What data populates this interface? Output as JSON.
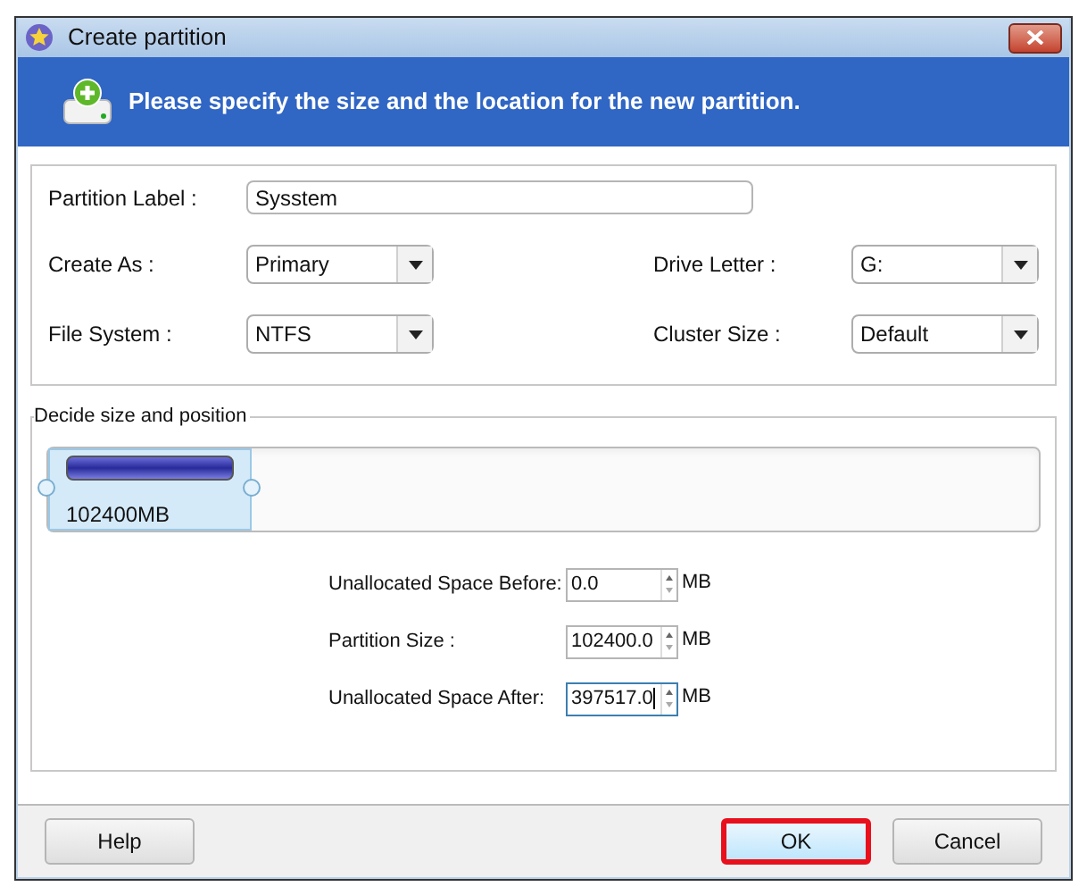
{
  "window": {
    "title": "Create partition"
  },
  "banner": {
    "text": "Please specify the size and the location for the new partition."
  },
  "settings": {
    "partition_label": {
      "label": "Partition Label :",
      "value": "Sysstem"
    },
    "dropdowns": [
      {
        "label": "Create As :",
        "value": "Primary"
      },
      {
        "label": "Drive Letter :",
        "value": "G:"
      },
      {
        "label": "File System :",
        "value": "NTFS"
      },
      {
        "label": "Cluster Size :",
        "value": "Default"
      }
    ]
  },
  "size_position": {
    "title": "Decide size and position",
    "disk_map": {
      "partition_size": "102400MB",
      "level": 0.2048
    },
    "fields": [
      {
        "label": "Unallocated Space Before:",
        "value": "0.0",
        "unit": "MB",
        "focused": false
      },
      {
        "label": "Partition Size :",
        "value": "102400.0",
        "unit": "MB",
        "focused": false
      },
      {
        "label": "Unallocated Space After:",
        "value": "397517.0",
        "unit": "MB",
        "focused": true
      }
    ]
  },
  "buttons": [
    {
      "label": "Help",
      "highlighted": false
    },
    {
      "label": "OK",
      "highlighted": true
    },
    {
      "label": "Cancel",
      "highlighted": false
    }
  ]
}
